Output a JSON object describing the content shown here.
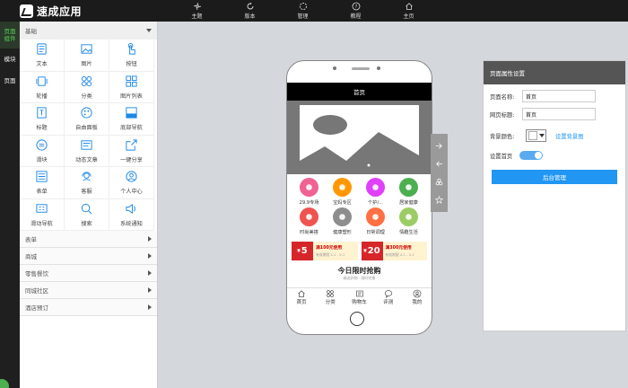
{
  "app": {
    "title": "速成应用"
  },
  "topnav": [
    "主题",
    "版本",
    "管理",
    "教程",
    "主页"
  ],
  "left_strip": [
    "页面组件",
    "模块",
    "页面"
  ],
  "panel": {
    "header": "基础",
    "components": [
      "文本",
      "图片",
      "按钮",
      "轮播",
      "分类",
      "图片列表",
      "标题",
      "自由面板",
      "底部导航",
      "滑块",
      "动态文章",
      "一键分享",
      "表单",
      "客服",
      "个人中心",
      "滑动导航",
      "搜索",
      "系统通知"
    ],
    "categories": [
      "表单",
      "商城",
      "零售餐饮",
      "同城社区",
      "酒店预订"
    ]
  },
  "phone": {
    "page_title": "首页",
    "icons": [
      {
        "label": "29.9专场",
        "color": "#f06292"
      },
      {
        "label": "宝妈专区",
        "color": "#ff9800"
      },
      {
        "label": "个护/...",
        "color": "#e040fb"
      },
      {
        "label": "居家健康",
        "color": "#4caf50"
      },
      {
        "label": "时尚美搭",
        "color": "#ef5350"
      },
      {
        "label": "健康塑形",
        "color": "#8d8d8d"
      },
      {
        "label": "日常调理",
        "color": "#ff7043"
      },
      {
        "label": "情趣生活",
        "color": "#9ccc65"
      }
    ],
    "coupons": [
      {
        "amount": "5",
        "currency": "¥",
        "title": "满100元使用",
        "sub": "有效期限 4.1 - 5.1"
      },
      {
        "amount": "20",
        "currency": "¥",
        "title": "满300元使用",
        "sub": "有效期限 4.1 - 5.1"
      }
    ],
    "flash_title": "今日限时抢购",
    "flash_sub": "精选好物 · 限时特惠",
    "tabs": [
      "首页",
      "分类",
      "购物车",
      "评测",
      "我的"
    ]
  },
  "properties": {
    "header": "页面属性设置",
    "page_name_label": "页面名称:",
    "page_name_value": "首页",
    "page_title_label": "网页标题:",
    "page_title_value": "首页",
    "bg_color_label": "背景颜色:",
    "set_bg_image": "设置背景图",
    "set_home_label": "设置首页",
    "set_home_on": true,
    "admin_button": "后台管理"
  }
}
